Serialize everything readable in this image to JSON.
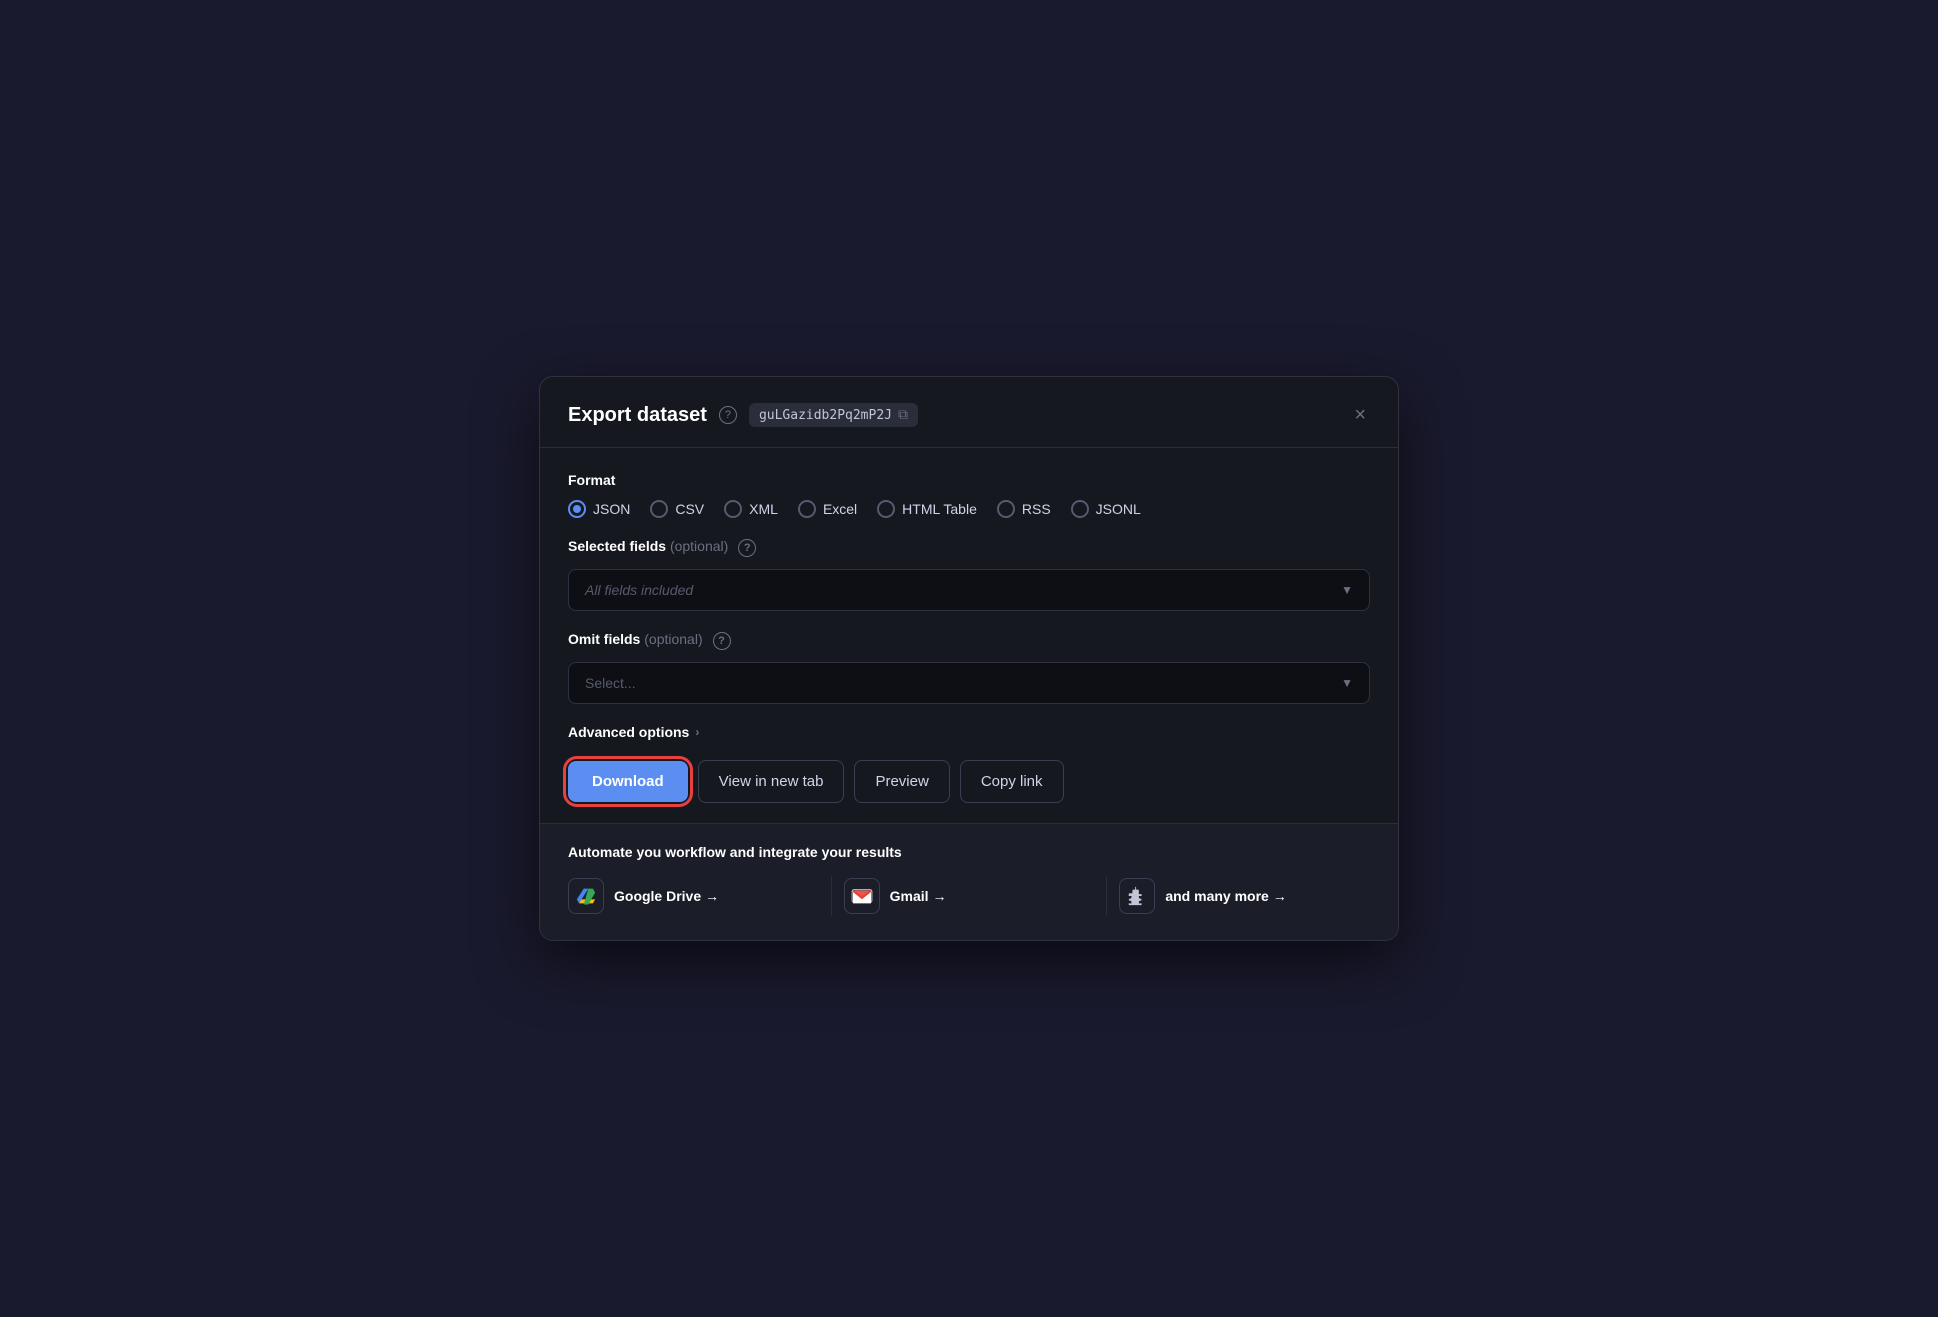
{
  "modal": {
    "title": "Export dataset",
    "dataset_id": "guLGazidb2Pq2mP2J",
    "close_label": "×"
  },
  "format": {
    "label": "Format",
    "options": [
      {
        "id": "json",
        "label": "JSON",
        "checked": true
      },
      {
        "id": "csv",
        "label": "CSV",
        "checked": false
      },
      {
        "id": "xml",
        "label": "XML",
        "checked": false
      },
      {
        "id": "excel",
        "label": "Excel",
        "checked": false
      },
      {
        "id": "html-table",
        "label": "HTML Table",
        "checked": false
      },
      {
        "id": "rss",
        "label": "RSS",
        "checked": false
      },
      {
        "id": "jsonl",
        "label": "JSONL",
        "checked": false
      }
    ]
  },
  "selected_fields": {
    "label": "Selected fields",
    "optional_label": "(optional)",
    "placeholder": "All fields included"
  },
  "omit_fields": {
    "label": "Omit fields",
    "optional_label": "(optional)",
    "placeholder": "Select..."
  },
  "advanced_options": {
    "label": "Advanced options"
  },
  "actions": {
    "download": "Download",
    "view_in_new_tab": "View in new tab",
    "preview": "Preview",
    "copy_link": "Copy link"
  },
  "footer": {
    "title": "Automate you workflow and integrate your results",
    "integrations": [
      {
        "id": "google-drive",
        "label": "Google Drive →"
      },
      {
        "id": "gmail",
        "label": "Gmail →"
      },
      {
        "id": "more",
        "label": "and many more →"
      }
    ]
  }
}
